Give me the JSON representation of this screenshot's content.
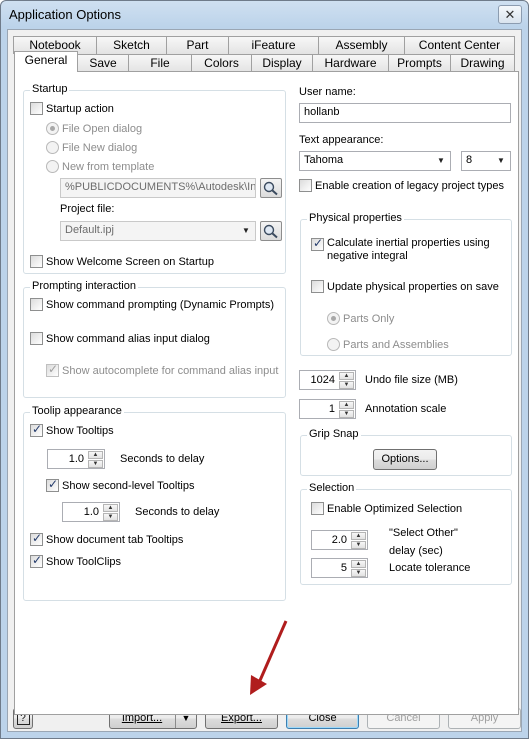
{
  "window": {
    "title": "Application Options",
    "close_glyph": "✕"
  },
  "tabs_row1": [
    "Notebook",
    "Sketch",
    "Part",
    "iFeature",
    "Assembly",
    "Content Center"
  ],
  "tabs_row2": [
    "General",
    "Save",
    "File",
    "Colors",
    "Display",
    "Hardware",
    "Prompts",
    "Drawing"
  ],
  "startup": {
    "title": "Startup",
    "startup_action": "Startup action",
    "file_open": "File Open dialog",
    "file_new": "File New dialog",
    "new_from_template": "New from template",
    "template_path": "%PUBLICDOCUMENTS%\\Autodesk\\Inv",
    "project_file_label": "Project file:",
    "project_file_value": "Default.ipj",
    "show_welcome": "Show Welcome Screen on Startup"
  },
  "prompting": {
    "title": "Prompting interaction",
    "show_command_prompting": "Show command prompting (Dynamic Prompts)",
    "show_alias_dialog": "Show command alias input dialog",
    "show_autocomplete": "Show autocomplete for command alias input"
  },
  "tooltip": {
    "title": "Toolip appearance",
    "show_tooltips": "Show Tooltips",
    "delay1_value": "1.0",
    "seconds_to_delay": "Seconds to delay",
    "show_second_level": "Show second-level Tooltips",
    "delay2_value": "1.0",
    "show_doc_tab": "Show document tab Tooltips",
    "show_toolclips": "Show ToolClips"
  },
  "user": {
    "username_label": "User name:",
    "username_value": "hollanb",
    "text_appearance_label": "Text appearance:",
    "font_value": "Tahoma",
    "size_value": "8",
    "legacy_label": "Enable creation of legacy project types"
  },
  "physical": {
    "title": "Physical properties",
    "calc_inertial_line1": "Calculate inertial properties using",
    "calc_inertial_line2": "negative integral",
    "update_on_save": "Update physical properties on save",
    "parts_only": "Parts Only",
    "parts_and_assemblies": "Parts and Assemblies"
  },
  "undo": {
    "value": "1024",
    "label": "Undo file size (MB)"
  },
  "annotation": {
    "value": "1",
    "label": "Annotation scale"
  },
  "grip": {
    "title": "Grip Snap",
    "options_button": "Options..."
  },
  "selection": {
    "title": "Selection",
    "enable_optimized": "Enable Optimized Selection",
    "select_other_value": "2.0",
    "select_other_line1": "\"Select Other\"",
    "select_other_line2": "delay (sec)",
    "locate_value": "5",
    "locate_label": "Locate tolerance"
  },
  "footer": {
    "help_glyph": "?",
    "import_label": "Import...",
    "export_label": "Export...",
    "close_label": "Close",
    "cancel_label": "Cancel",
    "apply_label": "Apply"
  },
  "colors": {
    "arrow": "#b01d1d",
    "window_frame": "#bcd3ea",
    "focus_border": "#3c7fb1"
  }
}
